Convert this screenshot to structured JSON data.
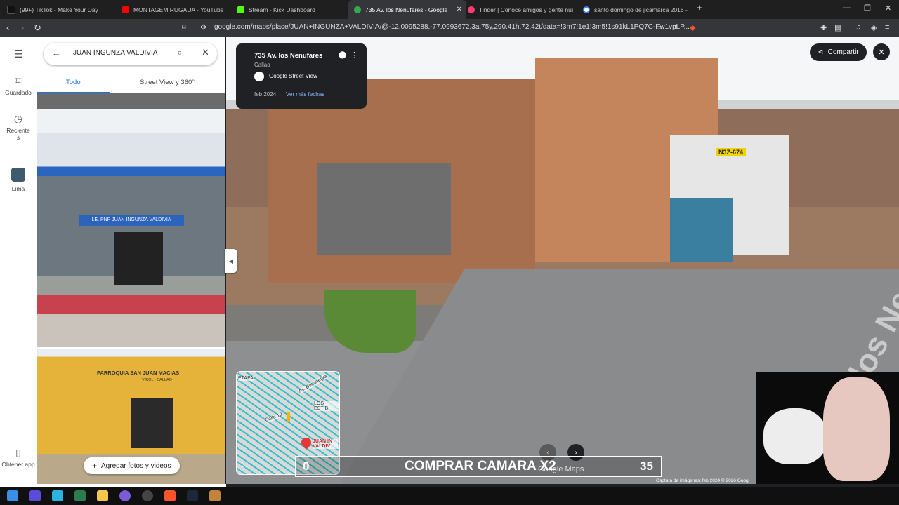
{
  "browser": {
    "tabs": [
      {
        "title": "(99+) TikTok - Make Your Day",
        "icon": "tiktok-icon",
        "color": "#111111"
      },
      {
        "title": "MONTAGEM RUGADA - YouTube",
        "icon": "youtube-icon",
        "color": "#ff0000"
      },
      {
        "title": "Stream - Kick Dashboard",
        "icon": "kick-icon",
        "color": "#53fc18"
      },
      {
        "title": "735 Av. los Nenufares - Google M",
        "icon": "maps-icon",
        "color": "#34a853"
      },
      {
        "title": "Tinder | Conoce amigos y gente nue",
        "icon": "tinder-icon",
        "color": "#fe3c72"
      },
      {
        "title": "santo domingo de jicamarca 2016 - E",
        "icon": "google-icon",
        "color": "#4285f4"
      }
    ],
    "url": "google.com/maps/place/JUAN+INGUNZA+VALDIVIA/@-12.0095288,-77.0993672,3a,75y,290.41h,72.42t/data=!3m7!1e1!3m5!1s91kL1PQ7C-Fw1vpLP..."
  },
  "rail": {
    "saved": "Guardado",
    "recents": "Reciente s",
    "lima": "Lima",
    "get_app": "Obtener app"
  },
  "search": {
    "query": "JUAN INGUNZA VALDIVIA",
    "tab_all": "Todo",
    "tab_streetview": "Street View y 360°",
    "add_photos": "Agregar fotos y videos",
    "photo1_sign": "I.E. PNP JUAN INGUNZA VALDIVIA",
    "photo2_sign": "PARROQUIA SAN JUAN MACIAS",
    "photo2_sub": "VIROL - CALLAO"
  },
  "streetview": {
    "place": "735 Av. los Nenufares",
    "city": "Callao",
    "source": "Google Street View",
    "date": "feb 2024",
    "more_dates": "Ver más fechas",
    "share": "Compartir",
    "plate": "N3Z-674",
    "street_name": "Av. los Nenufares",
    "watermark": "Google Maps",
    "credit": "Captura de imágenes: feb 2024   © 2026 Goog"
  },
  "minimap": {
    "labels": [
      "ETAPA",
      "Av. Bocanegra",
      "Calle 12",
      "LOS ESTIB",
      "JUAN IN VALDIV"
    ]
  },
  "overlay": {
    "left_value": "0",
    "text": "COMPRAR CAMARA X2",
    "right_value": "35"
  }
}
